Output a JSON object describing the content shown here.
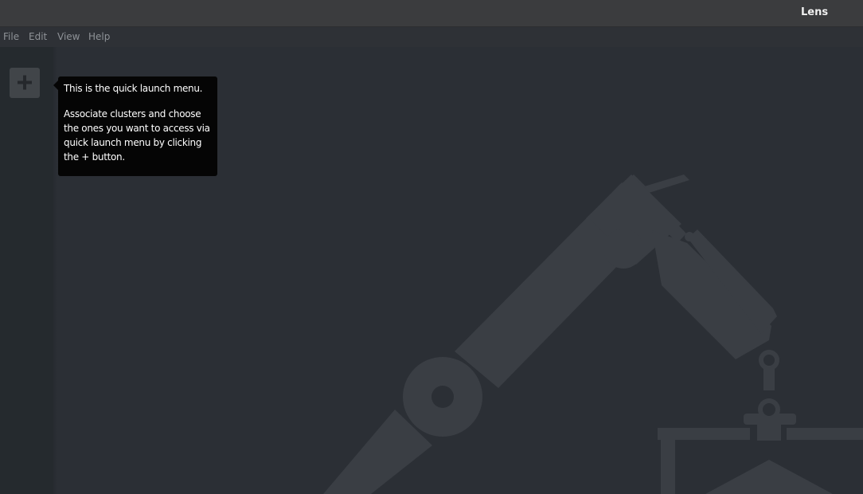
{
  "window": {
    "title": "Lens"
  },
  "menubar": {
    "items": [
      {
        "label": "File"
      },
      {
        "label": "Edit"
      },
      {
        "label": "View"
      },
      {
        "label": "Help"
      }
    ]
  },
  "sidebar": {
    "add_button_icon": "plus-icon"
  },
  "tooltip": {
    "line1": "This is the quick launch menu.",
    "line2": "Associate clusters and choose the ones you want to access via quick launch menu by clicking the + button."
  },
  "main": {
    "background_graphic": "robot-arm-illustration"
  },
  "colors": {
    "titlebar": "#3b3c3e",
    "menubar": "#2e3136",
    "sidebar": "#252a2e",
    "main": "#2b2f35",
    "tooltip": "#050505",
    "robot_art": "#3a3e44"
  }
}
